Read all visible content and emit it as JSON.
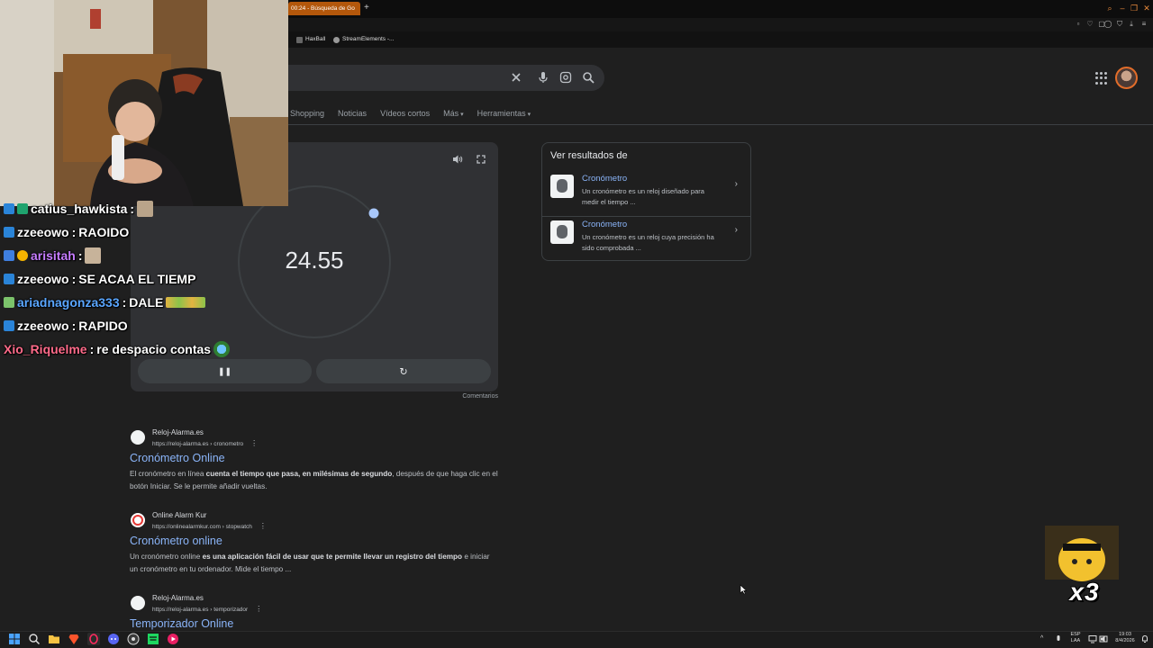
{
  "browser": {
    "active_tab_title": "00:24 - Búsqueda de Go",
    "new_tab_symbol": "+",
    "bookmarks": [
      {
        "label": "HaxBall"
      },
      {
        "label": "StreamElements -..."
      }
    ]
  },
  "google": {
    "nav_tabs": [
      {
        "label": "Shopping"
      },
      {
        "label": "Noticias"
      },
      {
        "label": "Vídeos cortos"
      },
      {
        "label": "Más"
      },
      {
        "label": "Herramientas"
      }
    ],
    "stopwatch": {
      "time": "24.55",
      "feedback": "Comentarios"
    },
    "side_panel": {
      "title": "Ver resultados de",
      "items": [
        {
          "name": "Cronómetro",
          "description": "Un cronómetro es un reloj diseñado para medir el tiempo ..."
        },
        {
          "name": "Cronómetro",
          "description": "Un cronómetro es un reloj cuya precisión ha sido comprobada ..."
        }
      ]
    },
    "results": [
      {
        "site": "Reloj-Alarma.es",
        "url": "https://reloj-alarma.es › cronometro",
        "title": "Cronómetro Online",
        "snippet_pre": "El cronómetro en línea ",
        "snippet_bold": "cuenta el tiempo que pasa, en milésimas de segundo",
        "snippet_post": ", después de que haga clic en el botón Iniciar. Se le permite añadir vueltas."
      },
      {
        "site": "Online Alarm Kur",
        "url": "https://onlinealarmkur.com › stopwatch",
        "title": "Cronómetro online",
        "snippet_pre": "Un cronómetro online ",
        "snippet_bold": "es una aplicación fácil de usar que te permite llevar un registro del tiempo",
        "snippet_post": " e iniciar un cronómetro en tu ordenador. Mide el tiempo ..."
      },
      {
        "site": "Reloj-Alarma.es",
        "url": "https://reloj-alarma.es › temporizador",
        "title": "Temporizador Online"
      }
    ]
  },
  "chat": [
    {
      "user": "catius_hawkista",
      "message": "",
      "color": "#ffffff"
    },
    {
      "user": "zzeeowo",
      "message": "RAOIDO",
      "color": "#ffffff"
    },
    {
      "user": "arisitah",
      "message": "",
      "color": "#c77dff"
    },
    {
      "user": "zzeeowo",
      "message": "SE ACAA EL TIEMP",
      "color": "#ffffff"
    },
    {
      "user": "ariadnagonza333",
      "message": "DALE",
      "color": "#5aa6ff"
    },
    {
      "user": "zzeeowo",
      "message": "RAPIDO",
      "color": "#ffffff"
    },
    {
      "user": "Xio_Riquelme",
      "message": "re despacio contas",
      "color": "#ff6b8a"
    }
  ],
  "chat_separator": ":",
  "alert": {
    "text": "x3"
  },
  "taskbar": {
    "language": "ESP",
    "language_sub": "LAA",
    "time": "19:03",
    "date": "8/4/2026"
  },
  "colors": {
    "link_blue": "#8ab4f8",
    "page_bg": "#1f1f1f",
    "card_bg": "#303134",
    "active_tab": "#b3570b",
    "stopwatch_dot": "#a8c7fa"
  }
}
